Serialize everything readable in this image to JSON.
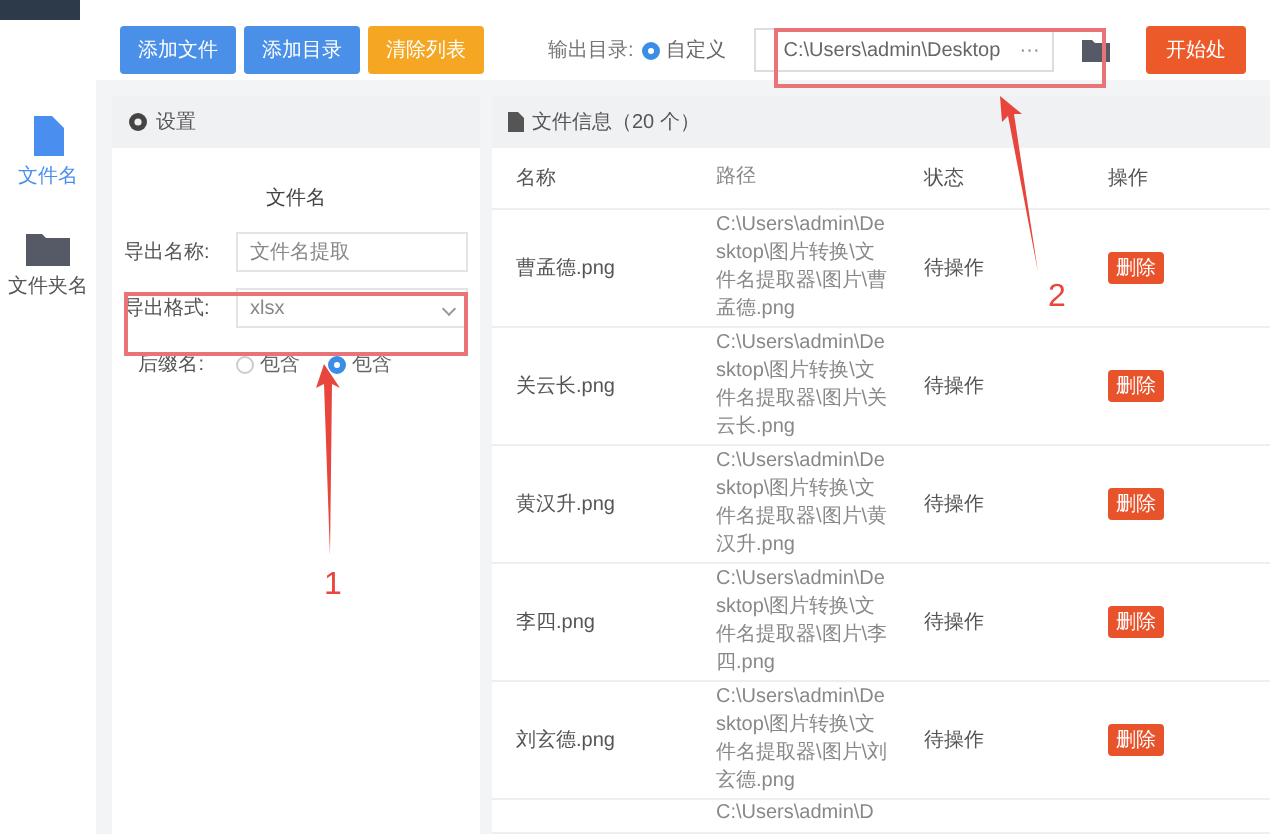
{
  "sidebar": {
    "items": [
      {
        "label": "文件名",
        "selected": true
      },
      {
        "label": "文件夹名",
        "selected": false
      }
    ]
  },
  "toolbar": {
    "buttons": [
      {
        "label": "添加文件",
        "kind": "primary"
      },
      {
        "label": "添加目录",
        "kind": "primary"
      },
      {
        "label": "清除列表",
        "kind": "warning"
      }
    ],
    "output_label": "输出目录:",
    "output_option": {
      "label": "自定义",
      "selected": true
    },
    "output_path": "C:\\Users\\admin\\Desktop",
    "browse": "···",
    "start_button": "开始处"
  },
  "settings": {
    "title": "设置",
    "section": "文件名",
    "export_name_label": "导出名称:",
    "export_name": "文件名提取",
    "export_format_label": "导出格式:",
    "export_format": "xlsx",
    "suffix_label": "后缀名:",
    "suffix_options": [
      {
        "label": "包含",
        "selected": false
      },
      {
        "label": "包含",
        "selected": true
      }
    ]
  },
  "files": {
    "title": "文件信息（20 个）",
    "columns": [
      "名称",
      "路径",
      "状态",
      "操作"
    ],
    "rows": [
      {
        "name": "曹孟德.png",
        "path": "C:\\Users\\admin\\Desktop\\图片转换\\文件名提取器\\图片\\曹孟德.png",
        "status": "待操作",
        "action": "删除"
      },
      {
        "name": "关云长.png",
        "path": "C:\\Users\\admin\\Desktop\\图片转换\\文件名提取器\\图片\\关云长.png",
        "status": "待操作",
        "action": "删除"
      },
      {
        "name": "黄汉升.png",
        "path": "C:\\Users\\admin\\Desktop\\图片转换\\文件名提取器\\图片\\黄汉升.png",
        "status": "待操作",
        "action": "删除"
      },
      {
        "name": "李四.png",
        "path": "C:\\Users\\admin\\Desktop\\图片转换\\文件名提取器\\图片\\李四.png",
        "status": "待操作",
        "action": "删除"
      },
      {
        "name": "刘玄德.png",
        "path": "C:\\Users\\admin\\Desktop\\图片转换\\文件名提取器\\图片\\刘玄德.png",
        "status": "待操作",
        "action": "删除"
      },
      {
        "path": "C:\\Users\\admin\\D"
      }
    ]
  },
  "annotations": [
    {
      "label": "1"
    },
    {
      "label": "2"
    }
  ]
}
